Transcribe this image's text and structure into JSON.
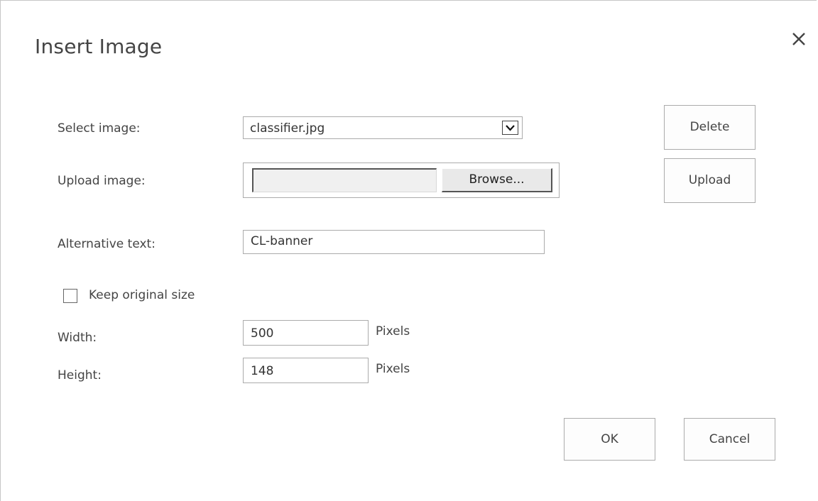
{
  "dialog": {
    "title": "Insert Image"
  },
  "form": {
    "select_image_label": "Select image:",
    "select_image_value": "classifier.jpg",
    "upload_image_label": "Upload image:",
    "browse_label": "Browse...",
    "alt_text_label": "Alternative text:",
    "alt_text_value": "CL-banner",
    "keep_original_label": "Keep original size",
    "keep_original_checked": false,
    "width_label": "Width:",
    "width_value": "500",
    "height_label": "Height:",
    "height_value": "148",
    "unit": "Pixels"
  },
  "buttons": {
    "delete": "Delete",
    "upload": "Upload",
    "ok": "OK",
    "cancel": "Cancel"
  },
  "icons": {
    "close": "close-icon",
    "dropdown": "chevron-down-icon"
  }
}
